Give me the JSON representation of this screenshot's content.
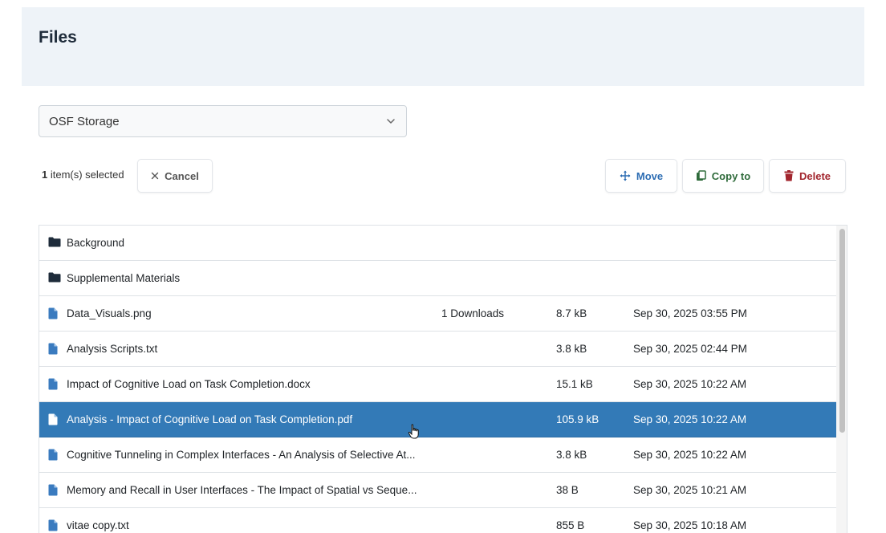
{
  "header": {
    "title": "Files"
  },
  "storage": {
    "selected": "OSF Storage"
  },
  "selection": {
    "count": "1",
    "suffix": " item(s) selected"
  },
  "toolbar": {
    "cancel_label": "Cancel",
    "move_label": "Move",
    "copy_label": "Copy to",
    "delete_label": "Delete"
  },
  "colors": {
    "selected_row": "#337ab7",
    "file_icon": "#3a7bbf",
    "folder_icon": "#1e2b3a",
    "move": "#2d6db3",
    "copy": "#2f6b3b",
    "delete": "#a2262e"
  },
  "files": [
    {
      "type": "folder",
      "icon": "folder-icon",
      "name": "Background",
      "downloads": "",
      "size": "",
      "date": ""
    },
    {
      "type": "folder",
      "icon": "folder-icon",
      "name": "Supplemental Materials",
      "downloads": "",
      "size": "",
      "date": ""
    },
    {
      "type": "file",
      "icon": "file-icon",
      "name": "Data_Visuals.png",
      "downloads": "1 Downloads",
      "size": "8.7 kB",
      "date": "Sep 30, 2025 03:55 PM"
    },
    {
      "type": "file",
      "icon": "file-icon",
      "name": "Analysis Scripts.txt",
      "downloads": "",
      "size": "3.8 kB",
      "date": "Sep 30, 2025 02:44 PM"
    },
    {
      "type": "file",
      "icon": "file-icon",
      "name": "Impact of Cognitive Load on Task Completion.docx",
      "downloads": "",
      "size": "15.1 kB",
      "date": "Sep 30, 2025 10:22 AM"
    },
    {
      "type": "file",
      "icon": "file-icon",
      "name": "Analysis - Impact of Cognitive Load on Task Completion.pdf",
      "downloads": "",
      "size": "105.9 kB",
      "date": "Sep 30, 2025 10:22 AM",
      "selected": true
    },
    {
      "type": "file",
      "icon": "file-icon",
      "name": "Cognitive Tunneling in Complex Interfaces - An Analysis of Selective At...",
      "downloads": "",
      "size": "3.8 kB",
      "date": "Sep 30, 2025 10:22 AM"
    },
    {
      "type": "file",
      "icon": "file-icon",
      "name": "Memory and Recall in User Interfaces - The Impact of Spatial vs Seque...",
      "downloads": "",
      "size": "38 B",
      "date": "Sep 30, 2025 10:21 AM"
    },
    {
      "type": "file",
      "icon": "file-icon",
      "name": "vitae copy.txt",
      "downloads": "",
      "size": "855 B",
      "date": "Sep 30, 2025 10:18 AM"
    }
  ]
}
